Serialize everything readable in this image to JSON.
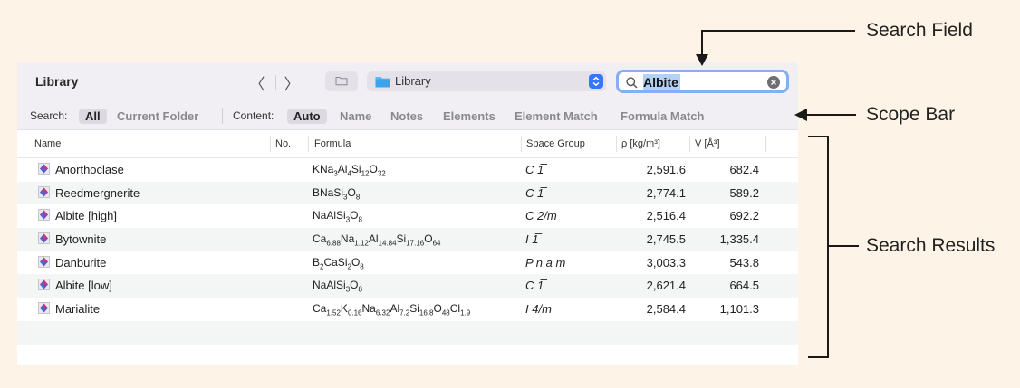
{
  "toolbar": {
    "title": "Library",
    "back_glyph": "〈",
    "forward_glyph": "〉",
    "path_label": "Library",
    "search_value": "Albite"
  },
  "scope_bar": {
    "search_label": "Search:",
    "search_options": [
      "All",
      "Current Folder"
    ],
    "search_selected": "All",
    "content_label": "Content:",
    "content_options": [
      "Auto",
      "Name",
      "Notes",
      "Elements",
      "Element Match",
      "Formula Match"
    ],
    "content_selected": "Auto"
  },
  "table": {
    "headers": {
      "name": "Name",
      "no": "No.",
      "formula": "Formula",
      "space_group": "Space Group",
      "rho": "ρ [kg/m³]",
      "volume": "V [Å³]"
    },
    "rows": [
      {
        "name": "Anorthoclase",
        "formula": "KNa<sub>3</sub>Al<sub>4</sub>Si<sub>12</sub>O<sub>32</sub>",
        "space_group": "C 1̅",
        "rho": "2,591.6",
        "volume": "682.4"
      },
      {
        "name": "Reedmergnerite",
        "formula": "BNaSi<sub>3</sub>O<sub>8</sub>",
        "space_group": "C 1̅",
        "rho": "2,774.1",
        "volume": "589.2"
      },
      {
        "name": "Albite [high]",
        "formula": "NaAlSi<sub>3</sub>O<sub>8</sub>",
        "space_group": "C 2/m",
        "rho": "2,516.4",
        "volume": "692.2"
      },
      {
        "name": "Bytownite",
        "formula": "Ca<sub>6.88</sub>Na<sub>1.12</sub>Al<sub>14.84</sub>Si<sub>17.16</sub>O<sub>64</sub>",
        "space_group": "I 1̅",
        "rho": "2,745.5",
        "volume": "1,335.4"
      },
      {
        "name": "Danburite",
        "formula": "B<sub>2</sub>CaSi<sub>2</sub>O<sub>8</sub>",
        "space_group": "P n a m",
        "rho": "3,003.3",
        "volume": "543.8"
      },
      {
        "name": "Albite [low]",
        "formula": "NaAlSi<sub>3</sub>O<sub>8</sub>",
        "space_group": "C 1̅",
        "rho": "2,621.4",
        "volume": "664.5"
      },
      {
        "name": "Marialite",
        "formula": "Ca<sub>1.52</sub>K<sub>0.16</sub>Na<sub>6.32</sub>Al<sub>7.2</sub>Si<sub>16.8</sub>O<sub>48</sub>Cl<sub>1.9</sub>",
        "space_group": "I 4/m",
        "rho": "2,584.4",
        "volume": "1,101.3"
      }
    ]
  },
  "callouts": {
    "search_field": "Search Field",
    "scope_bar": "Scope Bar",
    "search_results": "Search Results"
  },
  "colors": {
    "background": "#fdf3e6",
    "accent": "#3478f6",
    "search_focus_ring": "#87aef3"
  }
}
